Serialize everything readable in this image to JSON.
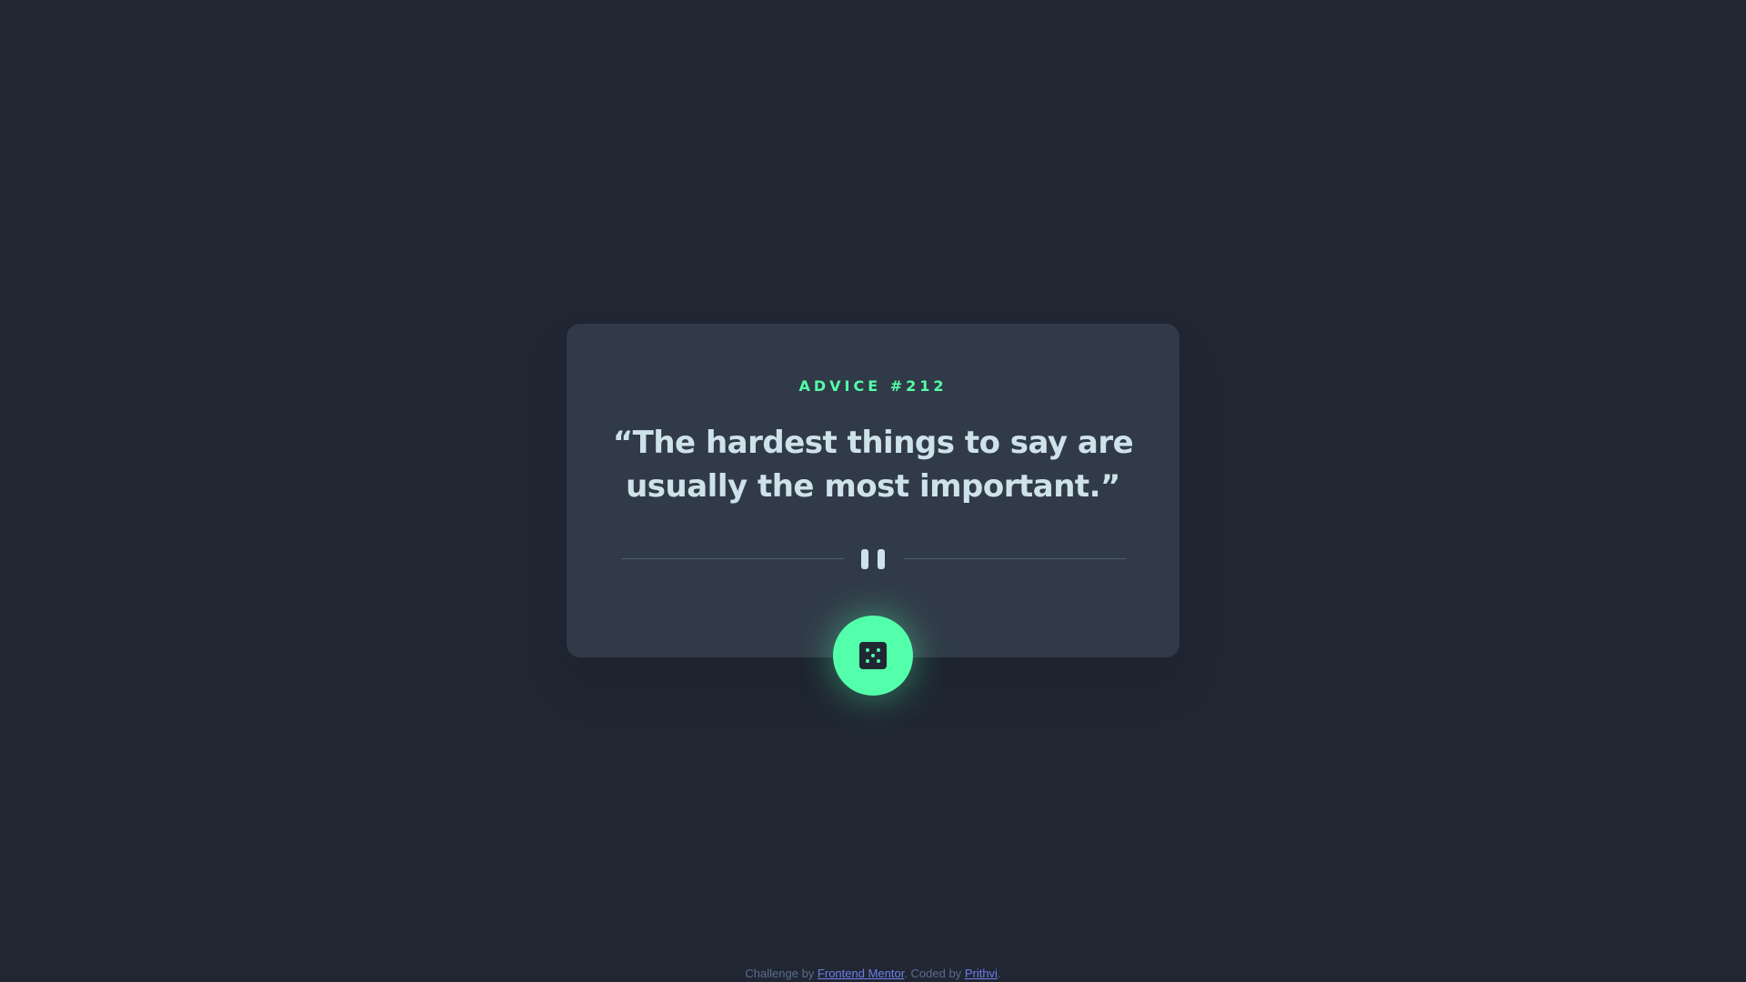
{
  "card": {
    "advice_label": "ADVICE #212",
    "quote": "“The hardest things to say are usually the most important.”"
  },
  "icons": {
    "divider": "pause-icon",
    "button": "dice-icon"
  },
  "colors": {
    "background": "#202733",
    "card": "#313a48",
    "accent": "#53ffaa",
    "text": "#cee3e9",
    "link": "#6e7ee8"
  },
  "footer": {
    "prefix": "Challenge by ",
    "link1": "Frontend Mentor",
    "middle": ". Coded by ",
    "link2": "Prithvi",
    "suffix": "."
  }
}
